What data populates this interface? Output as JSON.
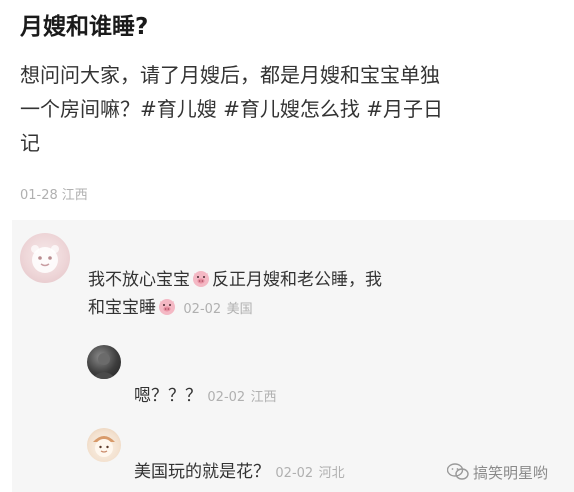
{
  "post": {
    "title": "月嫂和谁睡?",
    "body_lines": [
      "想问问大家，请了月嫂后，都是月嫂和宝宝单独",
      "一个房间嘛？#育儿嫂 #育儿嫂怎么找 #月子日",
      "记"
    ],
    "date": "01-28",
    "location": "江西"
  },
  "comments": [
    {
      "line1_a": "我不放心宝宝",
      "line1_b": "反正月嫂和老公睡，我",
      "line2_a": "和宝宝睡",
      "date": "02-02",
      "location": "美国",
      "emoji_icon": "pig-emoji-icon"
    },
    {
      "text": "嗯？？？",
      "date": "02-02",
      "location": "江西"
    },
    {
      "text": "美国玩的就是花？",
      "date": "02-02",
      "location": "河北"
    }
  ],
  "watermark": {
    "text": "搞笑明星哟"
  }
}
